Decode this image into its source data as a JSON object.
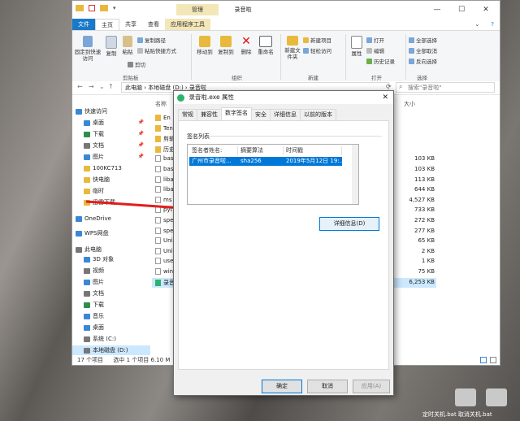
{
  "explorer": {
    "title": "录音啦",
    "manage_tab": "管理",
    "tabs": [
      "文件",
      "主页",
      "共享",
      "查看",
      "应用程序工具"
    ],
    "ribbon": {
      "pin_label": "固定到快速访问",
      "copy_label": "复制",
      "paste_label": "粘贴",
      "copy_path": "复制路径",
      "paste_shortcut": "粘贴快捷方式",
      "cut": "剪切",
      "clipboard_group": "剪贴板",
      "move_to": "移动到",
      "copy_to": "复制到",
      "delete": "删除",
      "rename": "重命名",
      "organize_group": "组织",
      "new_folder": "新建文件夹",
      "new_item": "新建项目",
      "easy_access": "轻松访问",
      "new_group": "新建",
      "properties": "属性",
      "open": "打开",
      "edit": "编辑",
      "history": "历史记录",
      "open_group": "打开",
      "select_all": "全部选择",
      "select_none": "全部取消",
      "invert": "反向选择",
      "select_group": "选择"
    },
    "address": "此电脑 › 本地磁盘 (D:) › 录音啦",
    "search_placeholder": "搜索\"录音啦\"",
    "col_name": "名称",
    "col_size": "大小",
    "nav": [
      {
        "label": "快速访问",
        "pin": false
      },
      {
        "label": "桌面",
        "pin": true
      },
      {
        "label": "下载",
        "pin": true
      },
      {
        "label": "文档",
        "pin": true
      },
      {
        "label": "图片",
        "pin": true
      },
      {
        "label": "100KC713",
        "pin": false
      },
      {
        "label": "快电脑",
        "pin": false
      },
      {
        "label": "临时",
        "pin": false
      },
      {
        "label": "迅雷下载",
        "pin": false
      },
      {
        "label": "OneDrive",
        "pin": false
      },
      {
        "label": "WPS网盘",
        "pin": false
      },
      {
        "label": "此电脑",
        "pin": false
      },
      {
        "label": "3D 对象",
        "pin": false
      },
      {
        "label": "视频",
        "pin": false
      },
      {
        "label": "图片",
        "pin": false
      },
      {
        "label": "文档",
        "pin": false
      },
      {
        "label": "下载",
        "pin": false
      },
      {
        "label": "音乐",
        "pin": false
      },
      {
        "label": "桌面",
        "pin": false
      },
      {
        "label": "系统 (C:)",
        "pin": false
      },
      {
        "label": "本地磁盘 (D:)",
        "pin": false
      }
    ],
    "files": [
      {
        "name": "En",
        "size": ""
      },
      {
        "name": "Ten",
        "size": ""
      },
      {
        "name": "剪辑",
        "size": ""
      },
      {
        "name": "历史",
        "size": ""
      },
      {
        "name": "bas",
        "size": "103 KB"
      },
      {
        "name": "bas",
        "size": "103 KB"
      },
      {
        "name": "liba",
        "size": "113 KB"
      },
      {
        "name": "liba",
        "size": "644 KB"
      },
      {
        "name": "ms",
        "size": "4,527 KB"
      },
      {
        "name": "pyt",
        "size": "733 KB"
      },
      {
        "name": "spe",
        "size": "272 KB"
      },
      {
        "name": "spe",
        "size": "277 KB"
      },
      {
        "name": "Uni",
        "size": "65 KB"
      },
      {
        "name": "Uni",
        "size": "2 KB"
      },
      {
        "name": "use",
        "size": "1 KB"
      },
      {
        "name": "win",
        "size": "75 KB"
      },
      {
        "name": "录音",
        "size": "6,253 KB"
      }
    ],
    "status_count": "17 个项目",
    "status_selected": "选中 1 个项目  6.10 M"
  },
  "dialog": {
    "title": "录音啦.exe 属性",
    "tabs": [
      "常规",
      "兼容性",
      "数字签名",
      "安全",
      "详细信息",
      "以前的版本"
    ],
    "list_label": "签名列表",
    "columns": [
      "签名者姓名:",
      "摘要算法",
      "时间戳"
    ],
    "row": [
      "广州市录音啦...",
      "sha256",
      "2019年5月12日 19:..."
    ],
    "details_button": "详细信息(D)",
    "ok": "确定",
    "cancel": "取消",
    "apply": "应用(A)"
  },
  "desktop": {
    "shortcut_label": "定时关机.bat  取消关机.bat"
  },
  "colors": {
    "accent": "#0078d7",
    "arrow": "#e21d1d",
    "file_tab": "#1979ca",
    "manage_tab": "#f3e7b8"
  }
}
